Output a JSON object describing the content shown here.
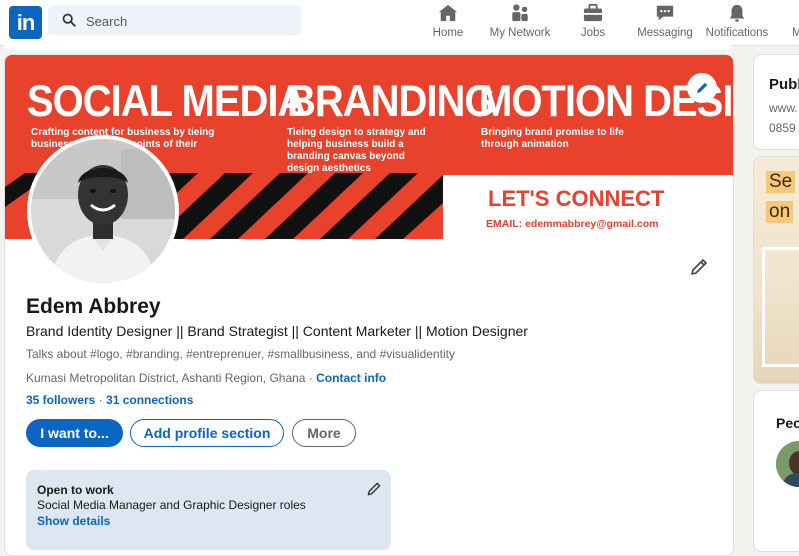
{
  "nav": {
    "logo": "in",
    "search_placeholder": "Search",
    "items": [
      {
        "label": "Home",
        "icon": "home-icon"
      },
      {
        "label": "My Network",
        "icon": "network-icon"
      },
      {
        "label": "Jobs",
        "icon": "briefcase-icon"
      },
      {
        "label": "Messaging",
        "icon": "messaging-icon"
      },
      {
        "label": "Notifications",
        "icon": "bell-icon"
      },
      {
        "label": "M",
        "icon": "me-icon"
      }
    ]
  },
  "banner": {
    "headings": [
      "SOCIAL MEDIA",
      "BRANDING",
      "MOTION DESIGN"
    ],
    "subs": [
      "Crafting content for business by tieing business to the pain points of their",
      "Tieing design to strategy and helping business build a branding canvas beyond design aesthetics",
      "Bringing brand promise to life through animation"
    ],
    "connect": "LET'S CONNECT",
    "email": "EMAIL: edemmabbrey@gmail.com",
    "colors": {
      "red": "#e8412c",
      "black": "#000000"
    }
  },
  "profile": {
    "name": "Edem Abbrey",
    "headline": "Brand Identity Designer || Brand Strategist || Content Marketer || Motion Designer",
    "talks": "Talks about #logo, #branding, #entreprenuer, #smallbusiness, and #visualidentity",
    "location": "Kumasi Metropolitan District, Ashanti Region, Ghana",
    "location_sep": " · ",
    "contact_info": "Contact info",
    "followers": "35 followers",
    "connections_sep": " · ",
    "connections": "31 connections",
    "buttons": {
      "primary": "I want to...",
      "add_section": "Add profile section",
      "more": "More"
    },
    "open_to_work": {
      "title": "Open to work",
      "roles": "Social Media Manager and Graphic Designer roles",
      "link": "Show details"
    }
  },
  "right": {
    "public_title": "Publ",
    "public_line1": "www.",
    "public_line2": "0859",
    "ad_line1": "Se",
    "ad_line2": "on",
    "people_title": "Peo"
  },
  "colors": {
    "linkedin_blue": "#0a66c2",
    "page_bg": "#f4f2ee",
    "open_to_work_bg": "#dde7f1"
  }
}
